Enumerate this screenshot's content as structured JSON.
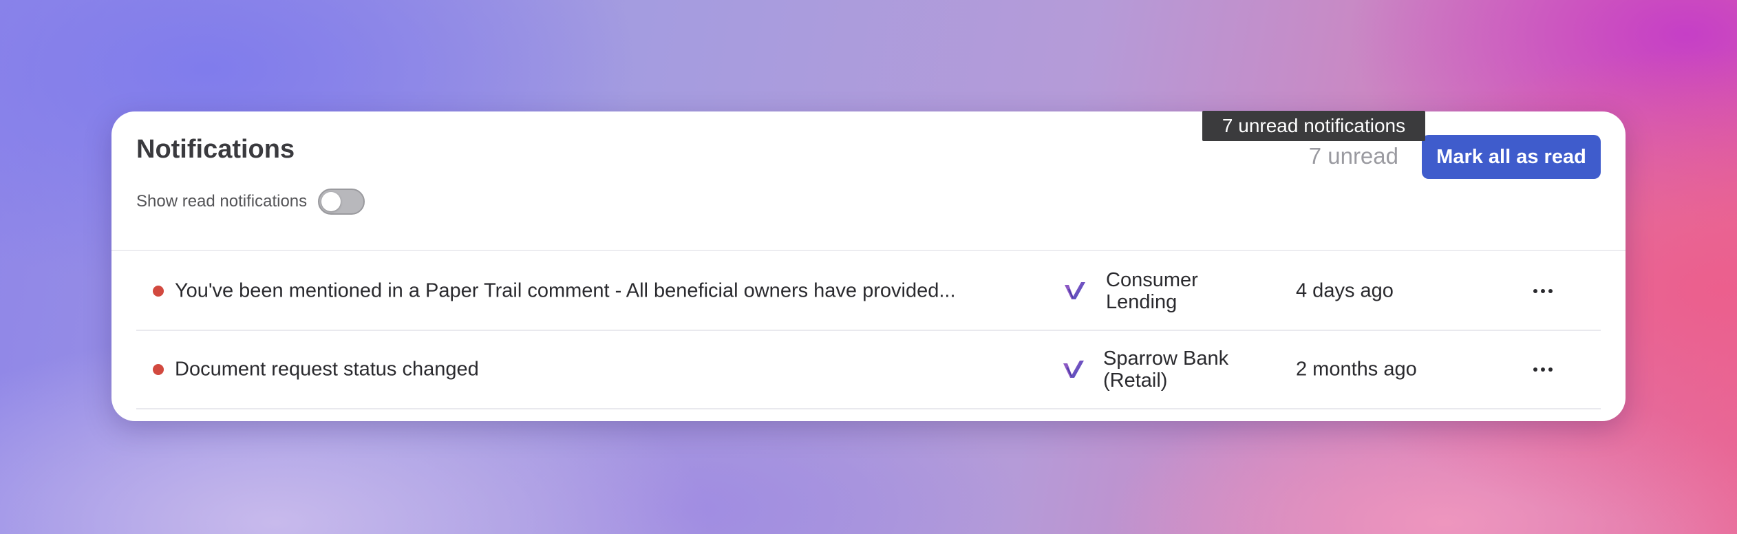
{
  "panel": {
    "title": "Notifications",
    "toggle_label": "Show read notifications",
    "toggle_on": false,
    "unread_count_text": "7 unread",
    "mark_all_label": "Mark all as read",
    "tooltip": "7 unread notifications"
  },
  "notifications": [
    {
      "title": "You've been mentioned in a Paper Trail comment - All beneficial owners have provided...",
      "org_line1": "Consumer",
      "org_line2": "Lending",
      "time": "4 days ago",
      "unread": true
    },
    {
      "title": "Document request status changed",
      "org_line1": "Sparrow Bank",
      "org_line2": "(Retail)",
      "time": "2 months ago",
      "unread": true
    }
  ],
  "colors": {
    "accent": "#3f5ccc",
    "unread_dot": "#d2493f",
    "tooltip_bg": "#3b3b3d"
  },
  "icons": {
    "org_logo": "v-logo-icon",
    "row_menu": "more-horizontal-icon"
  }
}
